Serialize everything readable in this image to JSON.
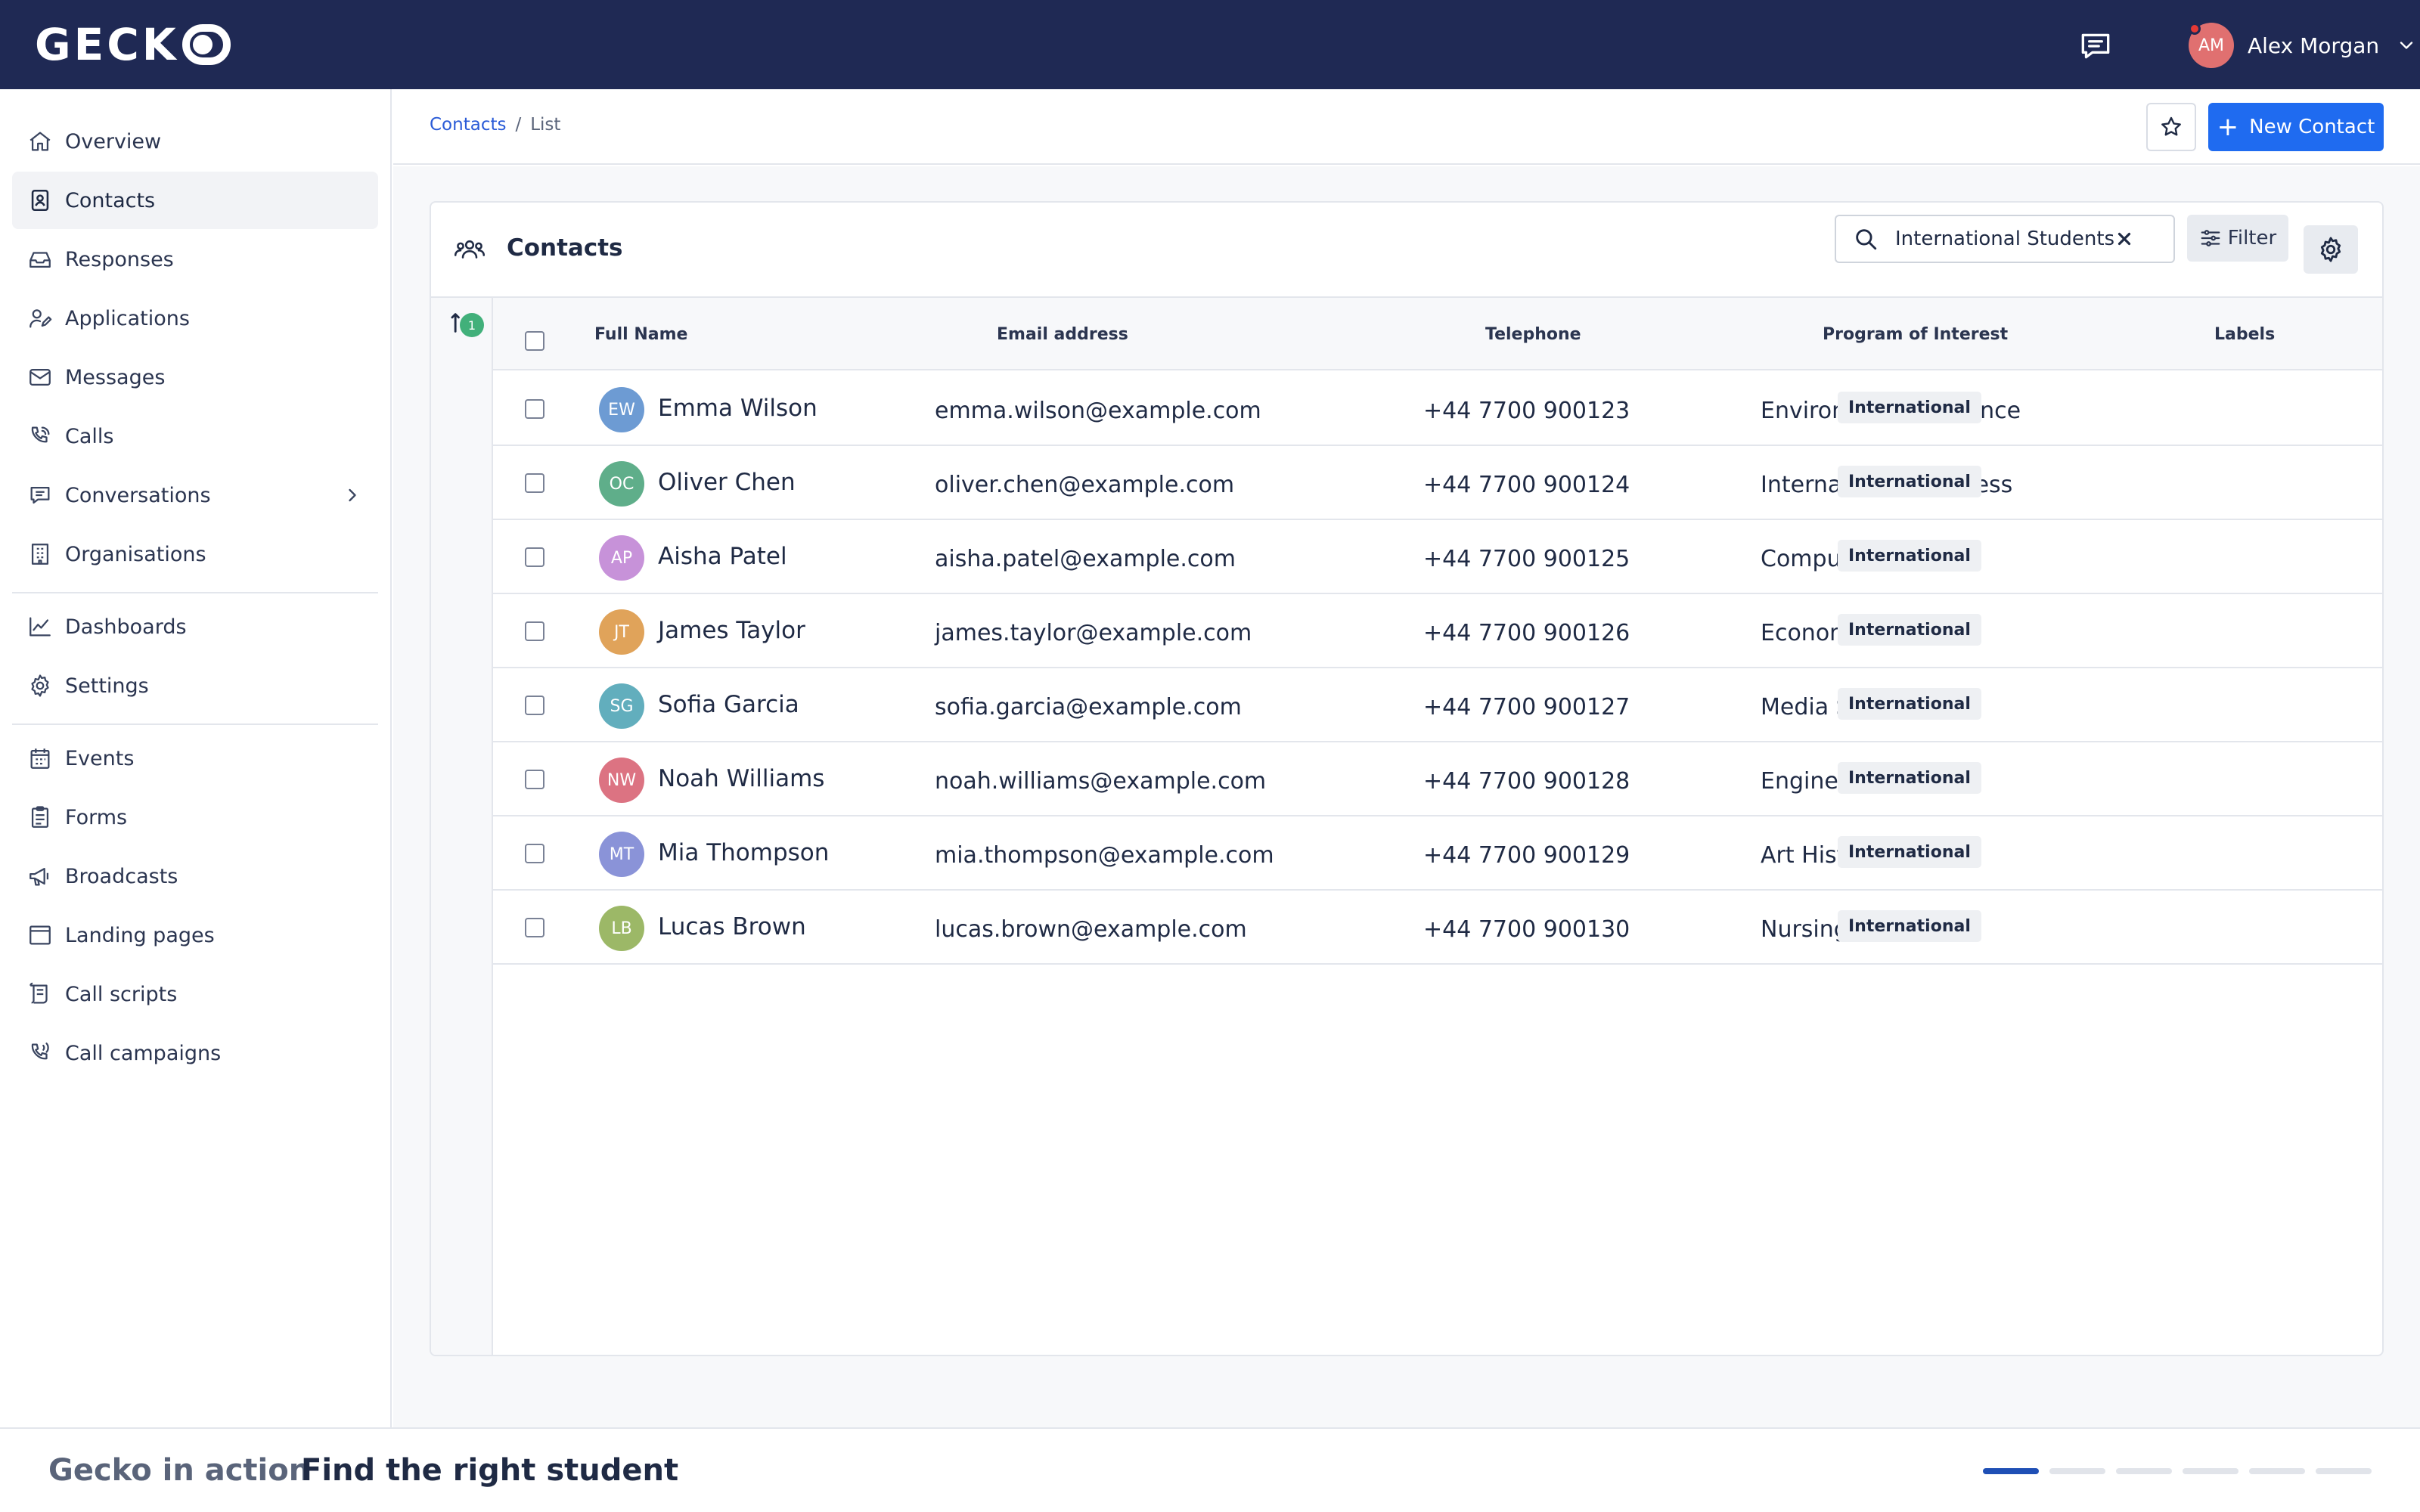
{
  "app": {
    "logo_text": "GECK"
  },
  "user": {
    "initials": "AM",
    "name": "Alex Morgan"
  },
  "sidebar": {
    "items": [
      {
        "label": "Overview",
        "icon": "home-icon"
      },
      {
        "label": "Contacts",
        "icon": "contact-card-icon",
        "active": true
      },
      {
        "label": "Responses",
        "icon": "inbox-icon"
      },
      {
        "label": "Applications",
        "icon": "user-edit-icon"
      },
      {
        "label": "Messages",
        "icon": "mail-icon"
      },
      {
        "label": "Calls",
        "icon": "phone-call-icon"
      },
      {
        "label": "Conversations",
        "icon": "chat-icon",
        "has_submenu": true
      },
      {
        "label": "Organisations",
        "icon": "building-icon"
      },
      {
        "label": "Dashboards",
        "icon": "chart-line-icon"
      },
      {
        "label": "Settings",
        "icon": "gear-icon"
      },
      {
        "label": "Events",
        "icon": "calendar-icon"
      },
      {
        "label": "Forms",
        "icon": "clipboard-icon"
      },
      {
        "label": "Broadcasts",
        "icon": "megaphone-icon"
      },
      {
        "label": "Landing pages",
        "icon": "browser-icon"
      },
      {
        "label": "Call scripts",
        "icon": "script-icon"
      },
      {
        "label": "Call campaigns",
        "icon": "phone-wave-icon"
      }
    ]
  },
  "header": {
    "breadcrumb": {
      "link": "Contacts",
      "separator": "/",
      "current": "List"
    },
    "new_button": "New Contact"
  },
  "card": {
    "title": "Contacts",
    "search_value": "International Students",
    "filter_label": "Filter",
    "sort_count": "1"
  },
  "table": {
    "columns": [
      "Full Name",
      "Email address",
      "Telephone",
      "Program of Interest",
      "Labels"
    ],
    "rows": [
      {
        "initials": "EW",
        "name": "Emma Wilson",
        "email": "emma.wilson@example.com",
        "phone": "+44 7700 900123",
        "program": "Environmental Science",
        "label": "International",
        "avatar_color": "#6d9bd3"
      },
      {
        "initials": "OC",
        "name": "Oliver Chen",
        "email": "oliver.chen@example.com",
        "phone": "+44 7700 900124",
        "program": "International Business",
        "label": "International",
        "avatar_color": "#5fae8a"
      },
      {
        "initials": "AP",
        "name": "Aisha Patel",
        "email": "aisha.patel@example.com",
        "phone": "+44 7700 900125",
        "program": "Computer Science",
        "label": "International",
        "avatar_color": "#c792d9"
      },
      {
        "initials": "JT",
        "name": "James Taylor",
        "email": "james.taylor@example.com",
        "phone": "+44 7700 900126",
        "program": "Economics",
        "label": "International",
        "avatar_color": "#e0a35a"
      },
      {
        "initials": "SG",
        "name": "Sofia Garcia",
        "email": "sofia.garcia@example.com",
        "phone": "+44 7700 900127",
        "program": "Media Studies",
        "label": "International",
        "avatar_color": "#62aebd"
      },
      {
        "initials": "NW",
        "name": "Noah Williams",
        "email": "noah.williams@example.com",
        "phone": "+44 7700 900128",
        "program": "Engineering",
        "label": "International",
        "avatar_color": "#dc7382"
      },
      {
        "initials": "MT",
        "name": "Mia Thompson",
        "email": "mia.thompson@example.com",
        "phone": "+44 7700 900129",
        "program": "Art History",
        "label": "International",
        "avatar_color": "#8a93d8"
      },
      {
        "initials": "LB",
        "name": "Lucas Brown",
        "email": "lucas.brown@example.com",
        "phone": "+44 7700 900130",
        "program": "Nursing",
        "label": "International",
        "avatar_color": "#9cb867"
      }
    ]
  },
  "footer": {
    "kicker": "Gecko in action",
    "title": "Find the right student",
    "progress_segments": 6,
    "active_segment": 1
  },
  "colors": {
    "topbar": "#1f2954",
    "accent": "#1f6bf0",
    "badge_green": "#41b07a"
  }
}
